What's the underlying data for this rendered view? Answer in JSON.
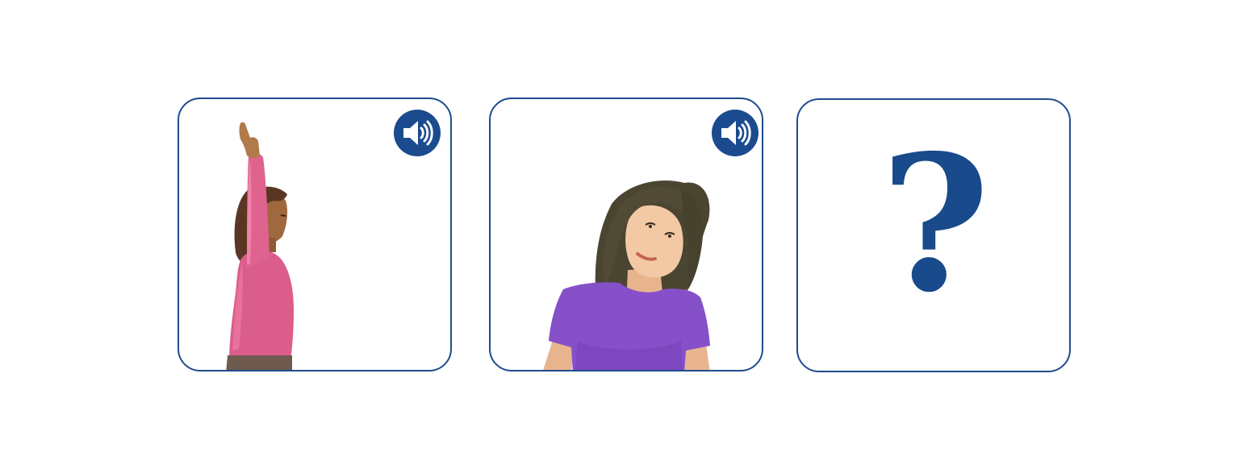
{
  "activity": {
    "cards": [
      {
        "figure": "person-arm-raised-stretch",
        "audio_icon": "speaker-icon",
        "audio_button_color": "#1b4b8e"
      },
      {
        "figure": "person-head-tilt-stretch",
        "audio_icon": "speaker-icon",
        "audio_button_color": "#1b4b8e"
      },
      {
        "symbol": "?",
        "symbol_color": "#184a8c"
      }
    ],
    "border_color": "#1f4c8f"
  }
}
